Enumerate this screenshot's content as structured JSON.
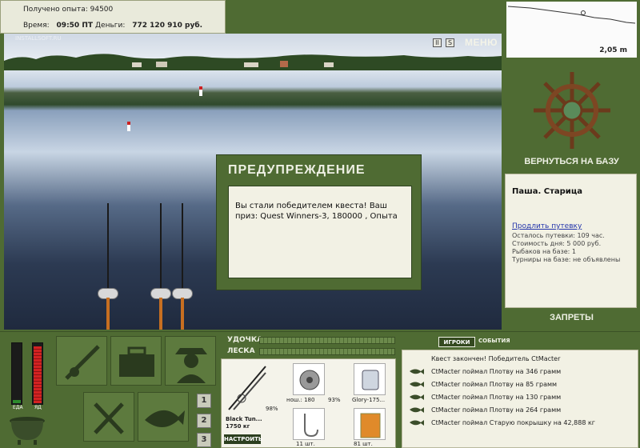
{
  "info": {
    "exp_label": "Получено опыта:",
    "exp_value": "94500",
    "time_label": "Время:",
    "time_value": "09:50 ПТ",
    "money_label": "Деньги:",
    "money_value": "772 120 910 руб.",
    "watermark": "INSTALLSOFT.RU"
  },
  "scene_controls": {
    "pause_icon": "pause-icon",
    "sound_label": "S",
    "menu_label": "МЕНЮ"
  },
  "dialog": {
    "title": "ПРЕДУПРЕЖДЕНИЕ",
    "message": "Вы стали победителем квеста! Ваш приз: Quest Winners-3, 180000 , Опыта"
  },
  "depth": {
    "value": "2,05 m"
  },
  "navigation": {
    "return_base": "ВЕРНУТЬСЯ НА БАЗУ",
    "bans": "ЗАПРЕТЫ"
  },
  "location": {
    "title": "Паша. Старица",
    "extend_link": "Продлить путевку",
    "remaining": "Осталось путевки: 109 час.",
    "day_cost": "Стоимость дня: 5 000 руб.",
    "fishers": "Рыбаков на базе: 1",
    "tournaments": "Турниры на базе: не объявлены"
  },
  "meters": {
    "food_label": "ЕДА",
    "poison_label": "ЯД",
    "food_level": 0.05,
    "poison_level": 0.93
  },
  "slots": [
    "1",
    "2",
    "3"
  ],
  "tackle": {
    "rod_label": "УДОЧКА",
    "line_label": "ЛЕСКА"
  },
  "inventory": {
    "rod_name": "Black Tun...",
    "rod_length": "1750 кг",
    "rod_condition": "98%",
    "reel_name": "нош.: 180",
    "reel_condition": "93%",
    "lure_name": "Glory-175...",
    "hook_text": "11 шт.",
    "bait_text": "81 шт.",
    "tune_button": "НАСТРОИТЬ"
  },
  "feed": {
    "tab_players": "ИГРОКИ",
    "tab_events": "СОБЫТИЯ",
    "items": [
      "Квест закончен! Победитель CtMacter",
      "CtMacter поймал Плотву на 346 грамм",
      "CtMacter поймал Плотву на 85 грамм",
      "CtMacter поймал Плотву на 130 грамм",
      "CtMacter поймал Плотву на 264 грамм",
      "CtMacter поймал Старую покрышку на 42,888 кг"
    ]
  },
  "colors": {
    "panel_green": "#4f6b33",
    "panel_cream": "#f2f1e4",
    "link_blue": "#2233aa",
    "handle_orange": "#c76f21"
  }
}
